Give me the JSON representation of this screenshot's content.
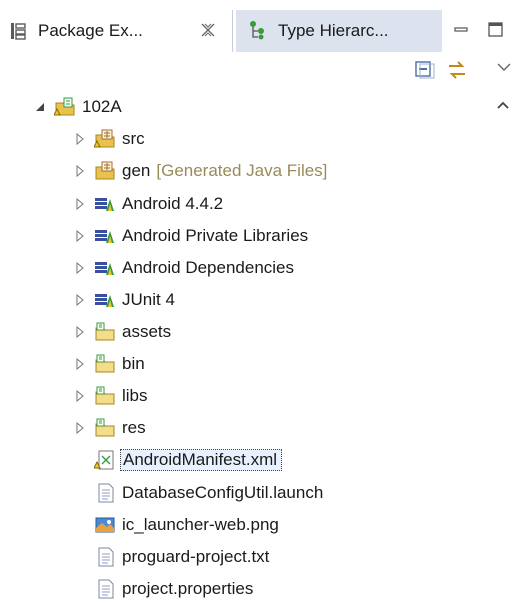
{
  "tabs": [
    {
      "label": "Package Ex...",
      "icon": "package-explorer-icon",
      "active": true
    },
    {
      "label": "Type Hierarc...",
      "icon": "type-hierarchy-icon",
      "active": false
    }
  ],
  "tree": {
    "project": "102A",
    "children": [
      {
        "label": "src",
        "icon": "source-folder-icon",
        "expandable": true
      },
      {
        "label": "gen",
        "decoration": "[Generated Java Files]",
        "icon": "source-folder-icon",
        "expandable": true
      },
      {
        "label": "Android 4.4.2",
        "icon": "library-icon",
        "expandable": true
      },
      {
        "label": "Android Private Libraries",
        "icon": "library-icon",
        "expandable": true
      },
      {
        "label": "Android Dependencies",
        "icon": "library-icon",
        "expandable": true
      },
      {
        "label": "JUnit 4",
        "icon": "library-icon",
        "expandable": true
      },
      {
        "label": "assets",
        "icon": "folder-icon",
        "expandable": true
      },
      {
        "label": "bin",
        "icon": "folder-icon",
        "expandable": true
      },
      {
        "label": "libs",
        "icon": "folder-icon",
        "expandable": true
      },
      {
        "label": "res",
        "icon": "folder-icon",
        "expandable": true
      },
      {
        "label": "AndroidManifest.xml",
        "icon": "xml-file-icon",
        "expandable": false,
        "selected": true
      },
      {
        "label": "DatabaseConfigUtil.launch",
        "icon": "file-icon",
        "expandable": false
      },
      {
        "label": "ic_launcher-web.png",
        "icon": "image-file-icon",
        "expandable": false
      },
      {
        "label": "proguard-project.txt",
        "icon": "file-icon",
        "expandable": false
      },
      {
        "label": "project.properties",
        "icon": "file-icon",
        "expandable": false
      }
    ]
  },
  "colors": {
    "tab_inactive": "#dde3ee",
    "selection": "#e9f1ff",
    "decoration": "#9a8a5a",
    "library_green": "#2f9e3c",
    "folder_yellow": "#e8c24a"
  }
}
